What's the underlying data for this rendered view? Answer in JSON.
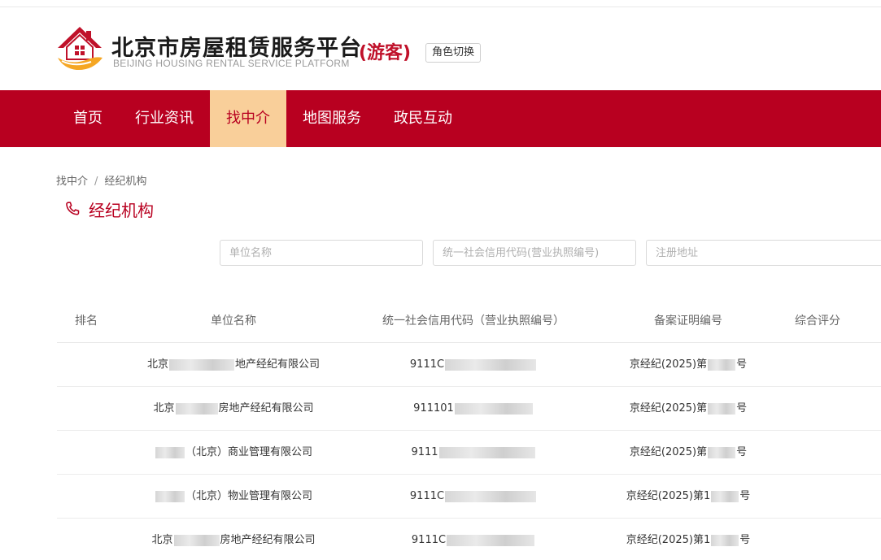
{
  "header": {
    "title": "北京市房屋租赁服务平台",
    "subtitle": "BEIJING HOUSING RENTAL SERVICE PLATFORM",
    "role": "(游客)",
    "role_switch_label": "角色切换"
  },
  "colors": {
    "brand_red": "#b80020",
    "nav_active_bg": "#f9cf9a",
    "logo_orange": "#f5a623"
  },
  "nav": {
    "items": [
      {
        "label": "首页"
      },
      {
        "label": "行业资讯"
      },
      {
        "label": "找中介",
        "active": true
      },
      {
        "label": "地图服务"
      },
      {
        "label": "政民互动"
      }
    ]
  },
  "breadcrumb": {
    "parent": "找中介",
    "separator": "/",
    "current": "经纪机构"
  },
  "section": {
    "icon": "phone-icon",
    "title": "经纪机构"
  },
  "search": {
    "name_placeholder": "单位名称",
    "code_placeholder": "统一社会信用代码(营业执照编号)",
    "address_placeholder": "注册地址"
  },
  "table": {
    "headers": {
      "rank": "排名",
      "name": "单位名称",
      "code": "统一社会信用代码（营业执照编号）",
      "cert": "备案证明编号",
      "score": "综合评分"
    },
    "rows": [
      {
        "rank": "",
        "name_pre": "北京",
        "name_post": "地产经纪有限公司",
        "code_pre": "9111C",
        "cert_pre": "京经纪(2025)第",
        "cert_post": "号",
        "score": ""
      },
      {
        "rank": "",
        "name_pre": "北京",
        "name_post": "房地产经纪有限公司",
        "code_pre": "911101",
        "cert_pre": "京经纪(2025)第",
        "cert_post": "号",
        "score": ""
      },
      {
        "rank": "",
        "name_pre": "",
        "name_post": "（北京）商业管理有限公司",
        "code_pre": "9111",
        "cert_pre": "京经纪(2025)第",
        "cert_post": "号",
        "score": ""
      },
      {
        "rank": "",
        "name_pre": "",
        "name_post": "（北京）物业管理有限公司",
        "code_pre": "9111C",
        "cert_pre": "京经纪(2025)第1",
        "cert_post": "号",
        "score": ""
      },
      {
        "rank": "",
        "name_pre": "北京",
        "name_post": "房地产经纪有限公司",
        "code_pre": "9111C",
        "cert_pre": "京经纪(2025)第1",
        "cert_post": "号",
        "score": ""
      }
    ]
  }
}
